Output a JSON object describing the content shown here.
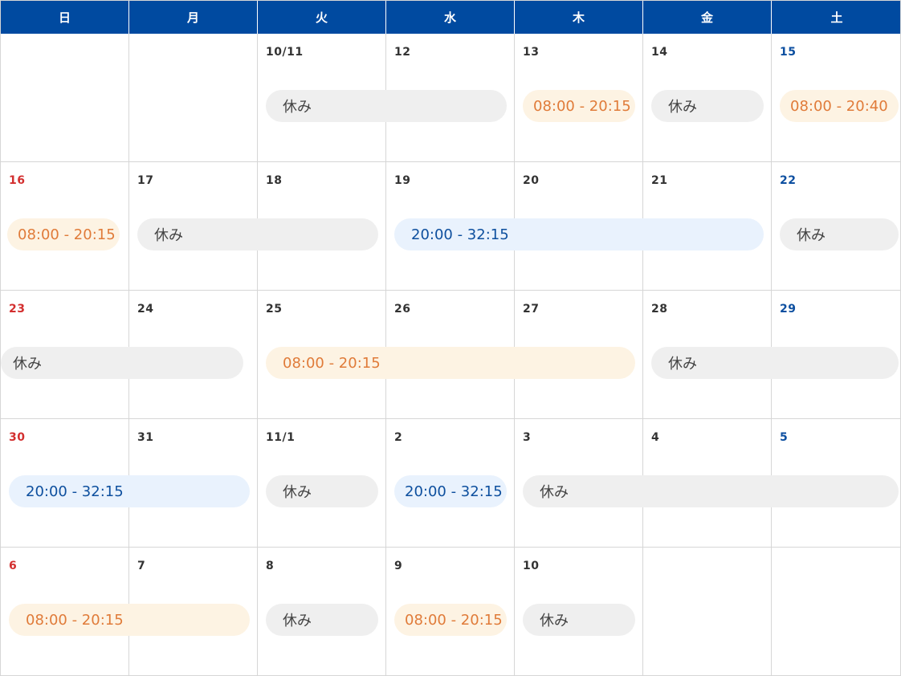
{
  "weekdays": [
    "日",
    "月",
    "火",
    "水",
    "木",
    "金",
    "土"
  ],
  "weeks": [
    {
      "dates": [
        "",
        "",
        "10/11",
        "12",
        "13",
        "14",
        "15"
      ],
      "shifts": [
        {
          "type": "off",
          "label": "休み",
          "start": 2,
          "span": 2
        },
        {
          "type": "day",
          "label": "08:00 - 20:15",
          "start": 4,
          "span": 1
        },
        {
          "type": "off",
          "label": "休み",
          "start": 5,
          "span": 1
        },
        {
          "type": "day",
          "label": "08:00 - 20:40",
          "start": 6,
          "span": 1
        }
      ]
    },
    {
      "dates": [
        "16",
        "17",
        "18",
        "19",
        "20",
        "21",
        "22"
      ],
      "shifts": [
        {
          "type": "day",
          "label": "08:00 - 20:15",
          "start": 0,
          "span": 1
        },
        {
          "type": "off",
          "label": "休み",
          "start": 1,
          "span": 2
        },
        {
          "type": "night",
          "label": "20:00 - 32:15",
          "start": 3,
          "span": 3
        },
        {
          "type": "off",
          "label": "休み",
          "start": 6,
          "span": 1
        }
      ]
    },
    {
      "dates": [
        "23",
        "24",
        "25",
        "26",
        "27",
        "28",
        "29"
      ],
      "shifts": [
        {
          "type": "off",
          "label": "休み",
          "start": 0,
          "span": 2
        },
        {
          "type": "day",
          "label": "08:00 - 20:15",
          "start": 2,
          "span": 3
        },
        {
          "type": "off",
          "label": "休み",
          "start": 5,
          "span": 2
        }
      ]
    },
    {
      "dates": [
        "30",
        "31",
        "11/1",
        "2",
        "3",
        "4",
        "5"
      ],
      "shifts": [
        {
          "type": "night",
          "label": "20:00 - 32:15",
          "start": 0,
          "span": 2
        },
        {
          "type": "off",
          "label": "休み",
          "start": 2,
          "span": 1
        },
        {
          "type": "night",
          "label": "20:00 - 32:15",
          "start": 3,
          "span": 1
        },
        {
          "type": "off",
          "label": "休み",
          "start": 4,
          "span": 3
        }
      ]
    },
    {
      "dates": [
        "6",
        "7",
        "8",
        "9",
        "10",
        "",
        ""
      ],
      "shifts": [
        {
          "type": "day",
          "label": "08:00 - 20:15",
          "start": 0,
          "span": 2
        },
        {
          "type": "off",
          "label": "休み",
          "start": 2,
          "span": 1
        },
        {
          "type": "day",
          "label": "08:00 - 20:15",
          "start": 3,
          "span": 1
        },
        {
          "type": "off",
          "label": "休み",
          "start": 4,
          "span": 1
        }
      ]
    }
  ],
  "colors": {
    "header_bg": "#004aa0",
    "sunday": "#d32f2f",
    "saturday": "#0d4fa0",
    "off_bg": "#efefef",
    "day_bg": "#fdf3e3",
    "day_text": "#e07b39",
    "night_bg": "#e9f2fd",
    "night_text": "#0d4f9e"
  }
}
